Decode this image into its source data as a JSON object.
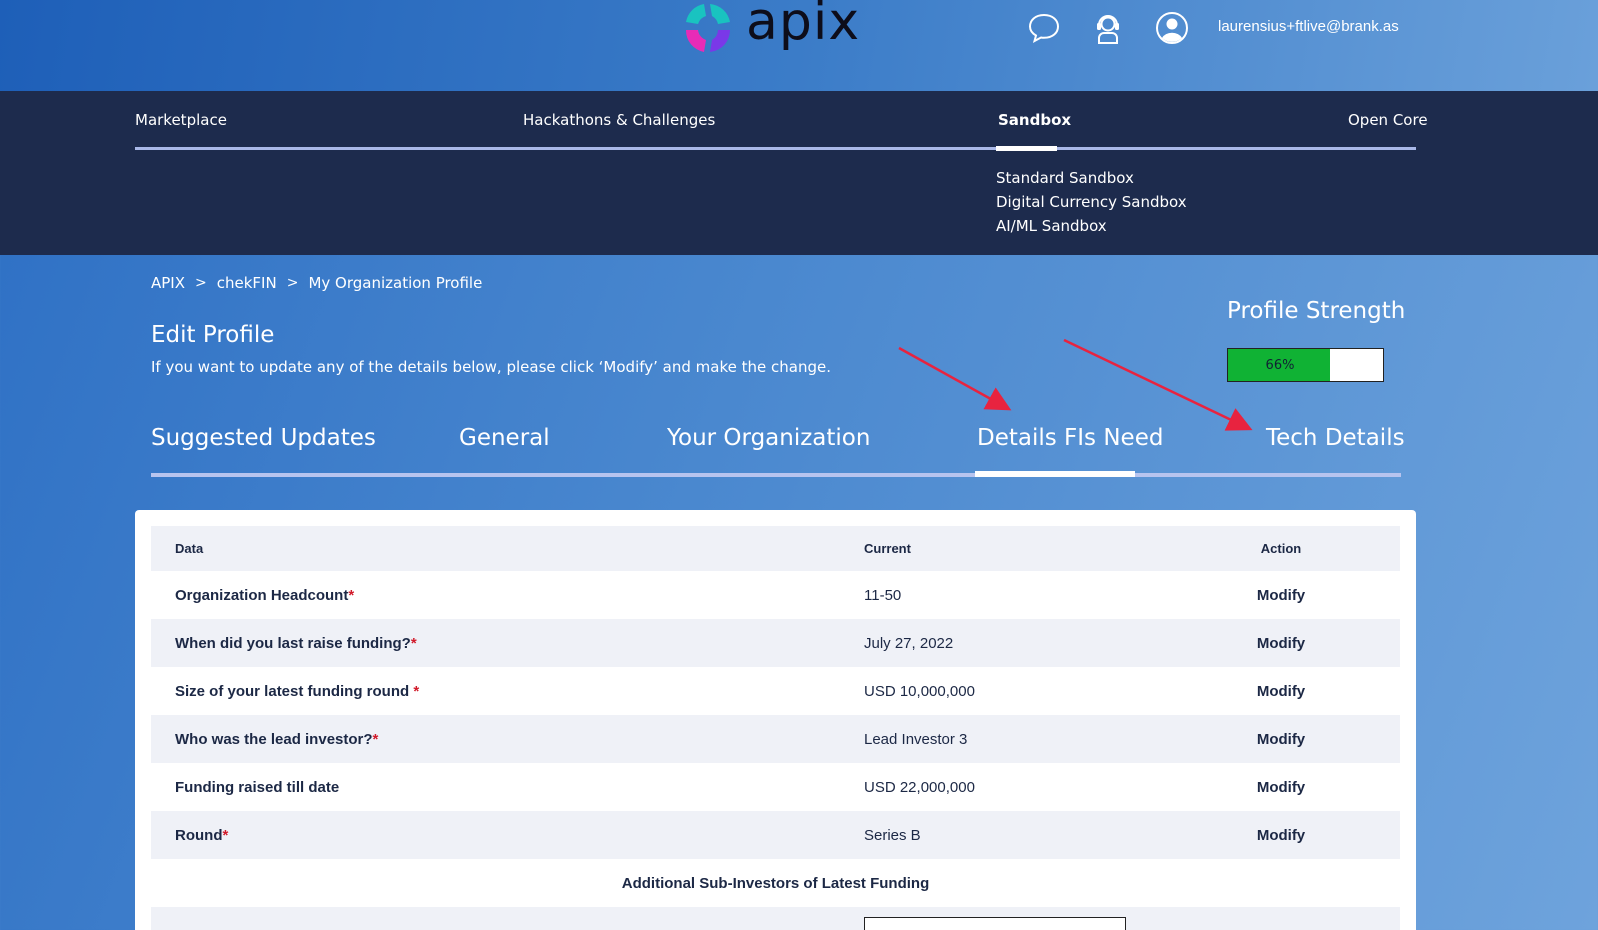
{
  "header": {
    "logo_text": "apix",
    "user_email": "laurensius+ftlive@brank.as",
    "icons": [
      "chat-icon",
      "support-agent-icon",
      "user-account-icon"
    ]
  },
  "nav": {
    "items": [
      {
        "label": "Marketplace",
        "active": false
      },
      {
        "label": "Hackathons & Challenges",
        "active": false
      },
      {
        "label": "Sandbox",
        "active": true
      },
      {
        "label": "Open Core",
        "active": false
      }
    ],
    "sandbox_submenu": [
      "Standard Sandbox",
      "Digital Currency Sandbox",
      "AI/ML Sandbox"
    ]
  },
  "breadcrumb": [
    "APIX",
    "chekFIN",
    "My Organization Profile"
  ],
  "page": {
    "title": "Edit Profile",
    "description": "If you want to update any of the details below, please click ‘Modify’ and make the change."
  },
  "profile_strength": {
    "title": "Profile Strength",
    "value": 66,
    "label": "66%",
    "fill_color": "#10b234"
  },
  "tabs": [
    {
      "label": "Suggested Updates",
      "active": false
    },
    {
      "label": "General",
      "active": false
    },
    {
      "label": "Your Organization",
      "active": false
    },
    {
      "label": "Details FIs Need",
      "active": true
    },
    {
      "label": "Tech Details",
      "active": false
    }
  ],
  "table": {
    "headers": {
      "data": "Data",
      "current": "Current",
      "action": "Action"
    },
    "rows": [
      {
        "label": "Organization Headcount",
        "required": "*",
        "current": "11-50",
        "action": "Modify"
      },
      {
        "label": "When did you last raise funding?",
        "required": "*",
        "current": "July 27, 2022",
        "action": "Modify"
      },
      {
        "label": "Size of your latest funding round ",
        "required": "*",
        "current": "USD 10,000,000",
        "action": "Modify"
      },
      {
        "label": "Who was the lead investor?",
        "required": "*",
        "current": "Lead Investor 3",
        "action": "Modify"
      },
      {
        "label": "Funding raised till date",
        "required": "",
        "current": "USD 22,000,000",
        "action": "Modify"
      },
      {
        "label": "Round",
        "required": "*",
        "current": "Series B",
        "action": "Modify"
      }
    ],
    "sub_heading": "Additional Sub-Investors of Latest Funding"
  },
  "colors": {
    "nav_bg": "#1d2b4d",
    "required_mark": "#d11a2a",
    "annotation_arrow": "#e8233f"
  }
}
